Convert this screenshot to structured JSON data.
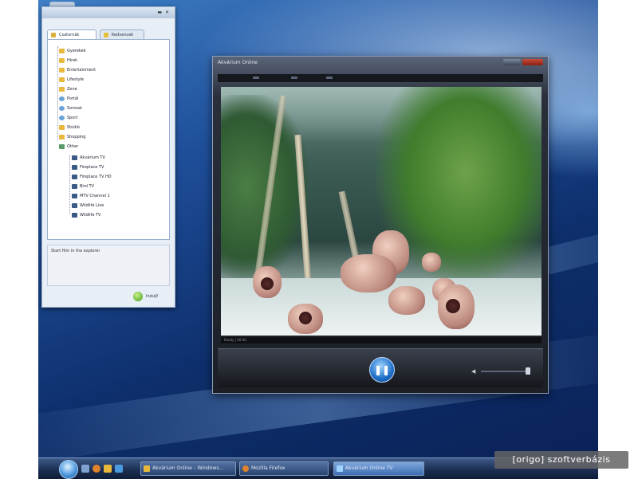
{
  "colors": {
    "accent": "#3d6db2",
    "desktop_dark": "#0e2f6c",
    "play_button": "#1f6fc8"
  },
  "channel_window": {
    "tabs": [
      {
        "label": "Csatornák",
        "icon": "tv-icon"
      },
      {
        "label": "Kedvencek",
        "icon": "star-icon"
      }
    ],
    "categories": [
      {
        "label": "Gyerekek",
        "icon": "folder-icon"
      },
      {
        "label": "Hírek",
        "icon": "folder-icon"
      },
      {
        "label": "Entertainment",
        "icon": "folder-icon"
      },
      {
        "label": "Lifestyle",
        "icon": "folder-icon"
      },
      {
        "label": "Zene",
        "icon": "folder-icon"
      },
      {
        "label": "Portál",
        "icon": "globe-icon"
      },
      {
        "label": "Sorozat",
        "icon": "globe-icon"
      },
      {
        "label": "Sport",
        "icon": "globe-icon"
      },
      {
        "label": "Stúdió",
        "icon": "folder-icon"
      },
      {
        "label": "Shopping",
        "icon": "folder-icon"
      },
      {
        "label": "Other",
        "icon": "folder-open-icon"
      }
    ],
    "channels": [
      {
        "label": "Akvárium TV",
        "icon": "channel-icon"
      },
      {
        "label": "Fireplace TV",
        "icon": "channel-icon"
      },
      {
        "label": "Fireplace TV HD",
        "icon": "channel-icon"
      },
      {
        "label": "Bird TV",
        "icon": "channel-icon"
      },
      {
        "label": "MTV Channel 1",
        "icon": "channel-icon"
      },
      {
        "label": "Wildlife Live",
        "icon": "channel-icon"
      },
      {
        "label": "Wildlife TV",
        "icon": "channel-icon"
      }
    ],
    "info_text": "Start film in the explorer",
    "start_label": "Indulj!"
  },
  "player_window": {
    "title": "Akvárium Online",
    "status_text": "Ready | 00:00"
  },
  "taskbar": {
    "buttons": [
      {
        "label": "Akvárium Online – Windows...",
        "active": false
      },
      {
        "label": "Mozilla Firefox",
        "active": false
      },
      {
        "label": "Akvárium Online TV",
        "active": true
      }
    ]
  },
  "watermark": "[origo] szoftverbázis"
}
